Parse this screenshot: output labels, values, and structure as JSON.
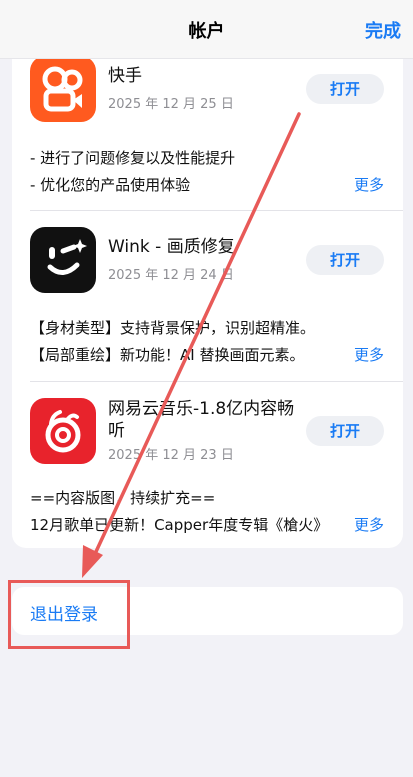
{
  "navbar": {
    "title": "帐户",
    "done_label": "完成"
  },
  "updates": [
    {
      "name": "快手",
      "date": "2025 年 12 月 25 日",
      "button": "打开",
      "notes": [
        "- 进行了问题修复以及性能提升",
        "- 优化您的产品使用体验"
      ],
      "more": "更多",
      "icon": "kuaishou-app-icon",
      "icon_color": "#ff5a1f"
    },
    {
      "name": "Wink - 画质修复",
      "date": "2025 年 12 月 24 日",
      "button": "打开",
      "notes": [
        "【身材美型】支持背景保护，识别超精准。",
        "【局部重绘】新功能！AI 替换画面元素。"
      ],
      "more": "更多",
      "icon": "wink-app-icon",
      "icon_color": "#111111"
    },
    {
      "name": "网易云音乐-1.8亿内容畅听",
      "date": "2025 年 12 月 23 日",
      "button": "打开",
      "notes": [
        "==内容版图，持续扩充==",
        "12月歌单已更新！Capper年度专辑《槍火》"
      ],
      "more": "更多",
      "icon": "netease-music-app-icon",
      "icon_color": "#e8232c"
    }
  ],
  "logout": {
    "label": "退出登录"
  },
  "annotation": {
    "arrow_color": "#e85a58"
  }
}
